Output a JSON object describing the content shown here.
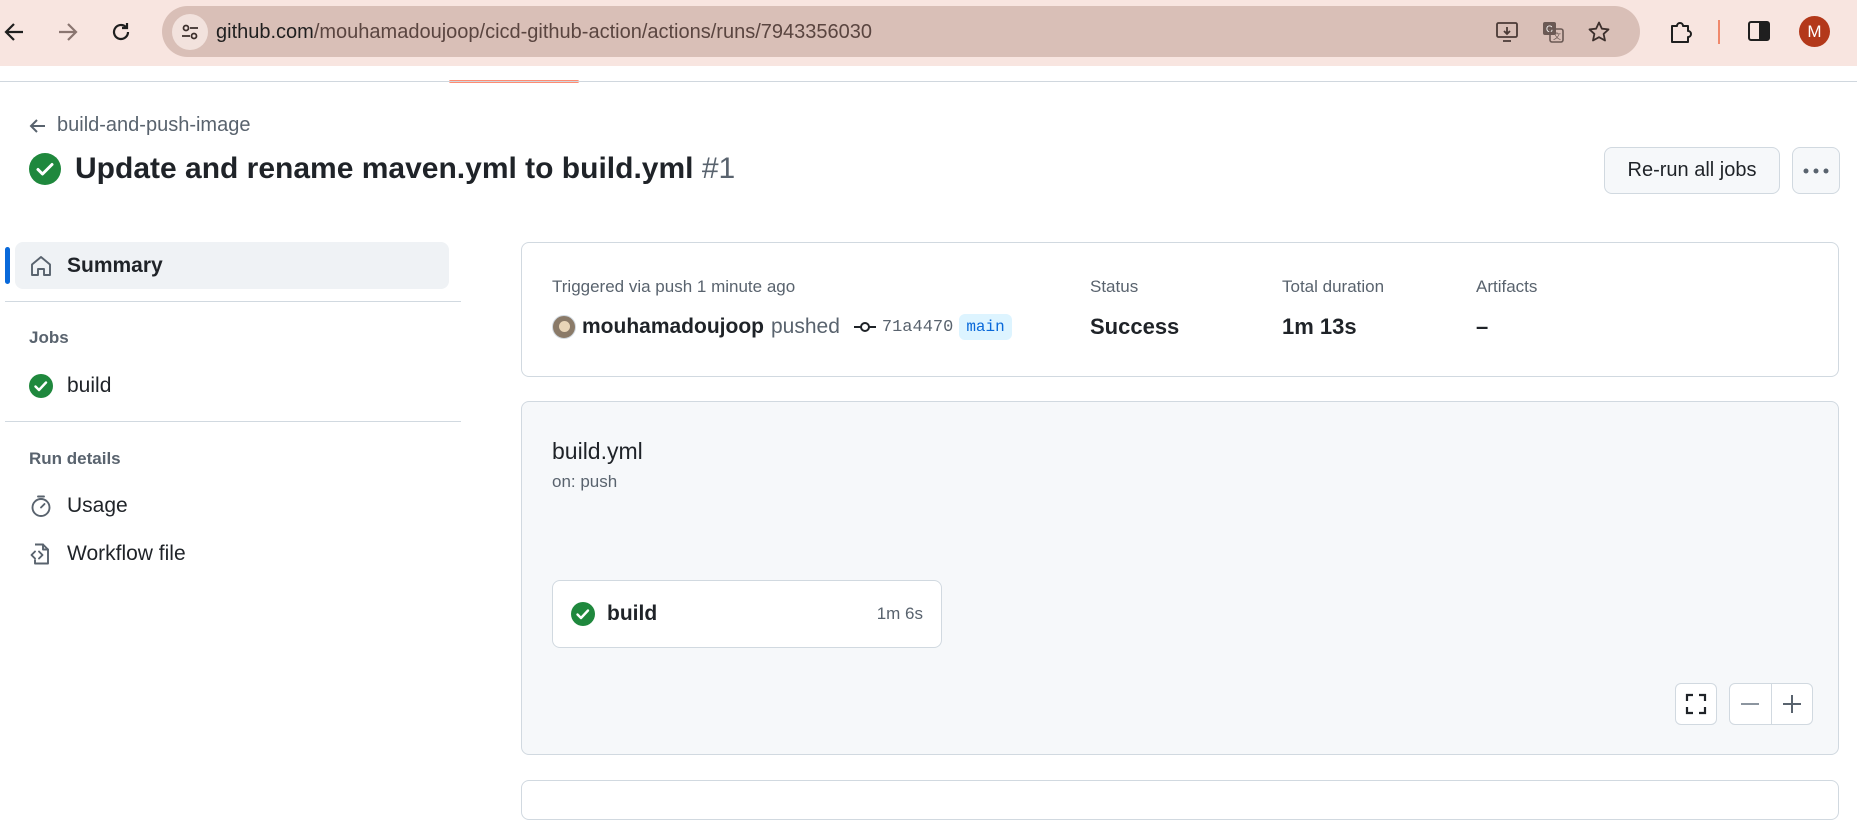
{
  "browser": {
    "url_host": "github.com",
    "url_path": "/mouhamadoujoop/cicd-github-action/actions/runs/7943356030",
    "profile_initial": "M"
  },
  "header": {
    "back_label": "build-and-push-image",
    "run_title": "Update and rename maven.yml to build.yml",
    "run_number": "#1",
    "rerun_label": "Re-run all jobs"
  },
  "sidebar": {
    "summary_label": "Summary",
    "jobs_heading": "Jobs",
    "jobs": [
      {
        "label": "build"
      }
    ],
    "run_details_heading": "Run details",
    "details": [
      {
        "label": "Usage"
      },
      {
        "label": "Workflow file"
      }
    ]
  },
  "summary": {
    "triggered_label": "Triggered via push 1 minute ago",
    "user": "mouhamadoujoop",
    "action": "pushed",
    "commit": "71a4470",
    "branch": "main",
    "status_label": "Status",
    "status_value": "Success",
    "duration_label": "Total duration",
    "duration_value": "1m 13s",
    "artifacts_label": "Artifacts",
    "artifacts_value": "–"
  },
  "workflow": {
    "name": "build.yml",
    "trigger": "on: push",
    "jobs": [
      {
        "name": "build",
        "duration": "1m 6s"
      }
    ]
  },
  "colors": {
    "success": "#1f883d",
    "accent": "#0969da",
    "chrome_bg": "#f8e5e0"
  }
}
